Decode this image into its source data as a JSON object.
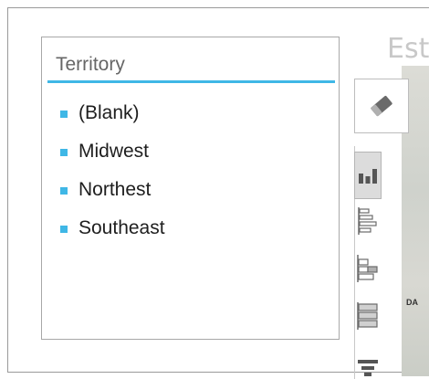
{
  "slicer": {
    "title": "Territory",
    "items": [
      {
        "label": "(Blank)"
      },
      {
        "label": "Midwest"
      },
      {
        "label": "Northest"
      },
      {
        "label": "Southeast"
      }
    ]
  },
  "map": {
    "title_fragment": "Est",
    "label_fragment": "DA"
  },
  "toolbar": {
    "tools": [
      "eraser-icon",
      "column-chart-icon",
      "bar-chart-icon",
      "stacked-bar-chart-icon",
      "clustered-bar-chart-icon",
      "funnel-chart-icon"
    ],
    "selected": "column-chart-icon"
  },
  "colors": {
    "accent": "#3fb7e6",
    "selected_tool_bg": "#dcdcdc",
    "icon_fill": "#6a6a6a"
  }
}
